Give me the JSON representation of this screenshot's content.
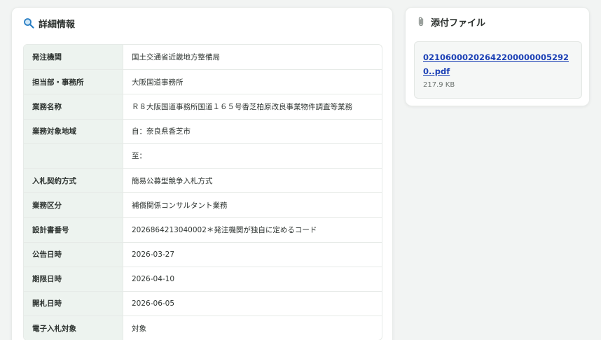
{
  "detail": {
    "title": "詳細情報",
    "rows": [
      {
        "label": "発注機関",
        "value": "国土交通省近畿地方整備局"
      },
      {
        "label": "担当部・事務所",
        "value": "大阪国道事務所"
      },
      {
        "label": "業務名称",
        "value": "Ｒ８大阪国道事務所国道１６５号香芝柏原改良事業物件調査等業務"
      },
      {
        "label": "業務対象地域",
        "value": "自：奈良県香芝市"
      },
      {
        "label": "",
        "value": "至："
      },
      {
        "label": "入札契約方式",
        "value": "簡易公募型競争入札方式"
      },
      {
        "label": "業務区分",
        "value": "補償関係コンサルタント業務"
      },
      {
        "label": "設計書番号",
        "value": "2026864213040002＊発注機関が独自に定めるコード"
      },
      {
        "label": "公告日時",
        "value": "2026-03-27"
      },
      {
        "label": "期限日時",
        "value": "2026-04-10"
      },
      {
        "label": "開札日時",
        "value": "2026-06-05"
      },
      {
        "label": "電子入札対象",
        "value": "対象"
      }
    ]
  },
  "attachments": {
    "title": "添付ファイル",
    "file": {
      "name": "021060002026422000000052920..pdf",
      "size": "217.9 KB"
    }
  },
  "icons": {
    "detail": "search-icon",
    "attachment": "paperclip-icon"
  }
}
